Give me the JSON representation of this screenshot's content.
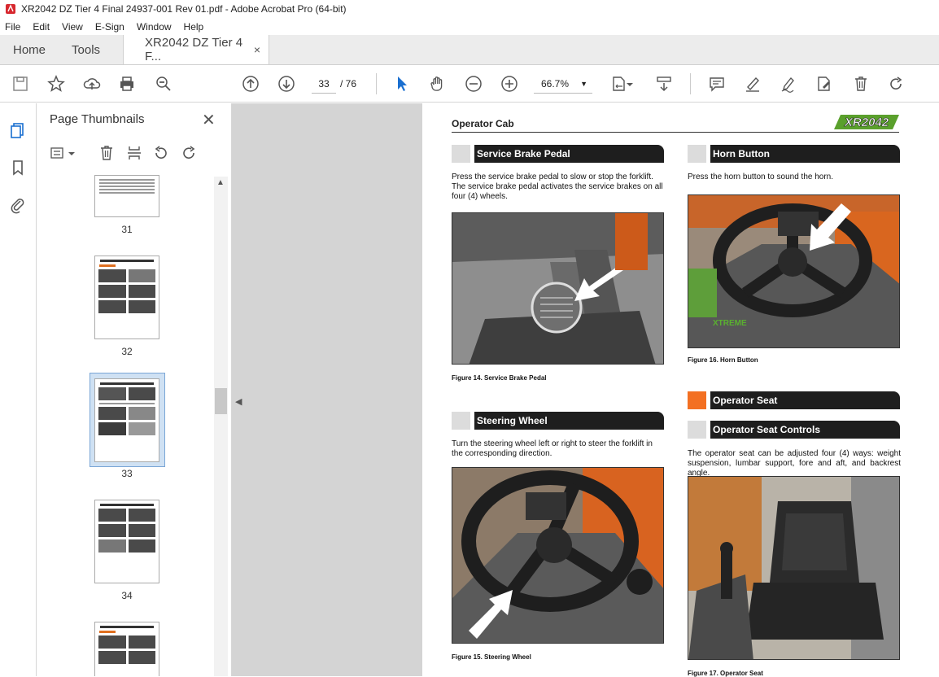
{
  "window": {
    "title": "XR2042 DZ Tier 4 Final 24937-001 Rev 01.pdf - Adobe Acrobat Pro (64-bit)"
  },
  "menu": [
    "File",
    "Edit",
    "View",
    "E-Sign",
    "Window",
    "Help"
  ],
  "tabs": {
    "home": "Home",
    "tools": "Tools",
    "document": "XR2042 DZ Tier 4 F...",
    "close": "×"
  },
  "toolbar": {
    "current_page": "33",
    "total_pages": "/ 76",
    "zoom": "66.7%"
  },
  "thumbnails": {
    "title": "Page Thumbnails",
    "close": "✕",
    "pages": [
      {
        "num": "31"
      },
      {
        "num": "32"
      },
      {
        "num": "33",
        "selected": true
      },
      {
        "num": "34"
      }
    ]
  },
  "page": {
    "header": "Operator Cab",
    "logo": "XR2042",
    "sections": {
      "service_brake": {
        "title": "Service Brake Pedal",
        "text": "Press the service brake pedal to slow or stop the forklift. The service brake pedal activates the service brakes on all four (4) wheels.",
        "caption": "Figure 14.  Service Brake Pedal"
      },
      "horn": {
        "title": "Horn Button",
        "text": "Press the horn button to sound the horn.",
        "caption": "Figure 16.  Horn Button"
      },
      "steering": {
        "title": "Steering Wheel",
        "text": "Turn the steering wheel left or right to steer the forklift in the corresponding direction.",
        "caption": "Figure 15.  Steering Wheel"
      },
      "operator_seat": {
        "title": "Operator Seat"
      },
      "seat_controls": {
        "title": "Operator Seat Controls",
        "text": "The operator seat can be adjusted four (4) ways: weight suspension, lumbar support, fore and aft, and backrest angle.",
        "caption": "Figure 17.  Operator Seat"
      }
    }
  },
  "colors": {
    "accent_orange": "#f37022",
    "section_bar": "#1e1e1e",
    "selection": "#cfe1f3"
  }
}
